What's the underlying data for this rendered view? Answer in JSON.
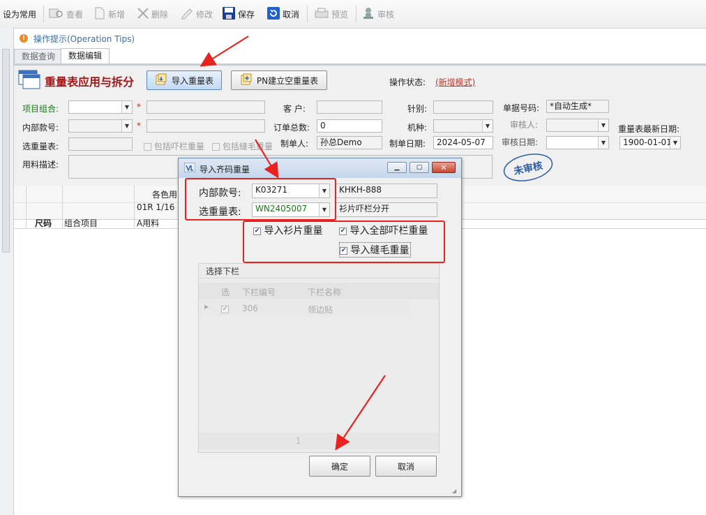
{
  "toolbar": {
    "set_default": "设为常用",
    "view": "查看",
    "new": "新增",
    "delete": "删除",
    "modify": "修改",
    "save": "保存",
    "cancel": "取消",
    "preview": "预览",
    "audit": "审核"
  },
  "tips": {
    "label": "操作提示(Operation Tips)"
  },
  "tabs": {
    "query": "数据查询",
    "edit": "数据编辑"
  },
  "header": {
    "title": "重量表应用与拆分",
    "import_button": "导入重量表",
    "pn_button": "PN建立空重量表",
    "status_label": "操作状态:",
    "status_value": "(新增模式)"
  },
  "form": {
    "project_group_label": "项目组合:",
    "internal_no_label": "内部款号:",
    "select_table_label": "选重量表:",
    "material_desc_label": "用料描述:",
    "include_trim_label": "包括吓栏重量",
    "include_seam_label": "包括缝毛重量",
    "customer_label": "客  户:",
    "order_total_label": "订单总数:",
    "order_total_value": "0",
    "creator_label": "制单人:",
    "creator_value": "孙总Demo",
    "needle_label": "针别:",
    "machine_label": "机种:",
    "create_date_label": "制单日期:",
    "create_date_value": "2024-05-07",
    "doc_no_label": "单据号码:",
    "doc_no_value": "*自动生成*",
    "auditor_label": "审核人:",
    "audit_date_label": "审核日期:",
    "latest_date_label": "重量表最新日期:",
    "latest_date_value": "1900-01-01",
    "stamp": "未审核"
  },
  "grid": {
    "header_color": "各色用",
    "row_01r": "01R 1/16",
    "col_size": "尺码",
    "col_group": "组合项目",
    "col_a": "A用料"
  },
  "dialog": {
    "title": "导入齐码重量",
    "internal_no_label": "内部款号:",
    "internal_no_value": "K03271",
    "internal_no_name": "KHKH-888",
    "select_table_label": "选重量表:",
    "select_table_value": "WN2405007",
    "select_table_desc": "衫片吓栏分开",
    "chk_piece": "导入衫片重量",
    "chk_all_trim": "导入全部吓栏重量",
    "chk_seam": "导入缝毛重量",
    "group_title": "选择下栏",
    "col_select": "选",
    "col_code": "下栏编号",
    "col_name": "下栏名称",
    "row_code": "306",
    "row_name": "领边贴",
    "page": "1",
    "ok": "确定",
    "cancel": "取消"
  },
  "colors": {
    "accent": "#e8231f",
    "title_red": "#a01818",
    "link": "#3b6ea5"
  },
  "icons": [
    "star-icon",
    "view-icon",
    "new-icon",
    "delete-icon",
    "edit-icon",
    "save-icon",
    "cancel-icon",
    "preview-icon",
    "audit-icon",
    "warning-icon",
    "window-icon",
    "import-icon",
    "pn-icon",
    "dropdown-icon",
    "app-icon",
    "minimize-icon",
    "maximize-icon",
    "close-icon"
  ]
}
